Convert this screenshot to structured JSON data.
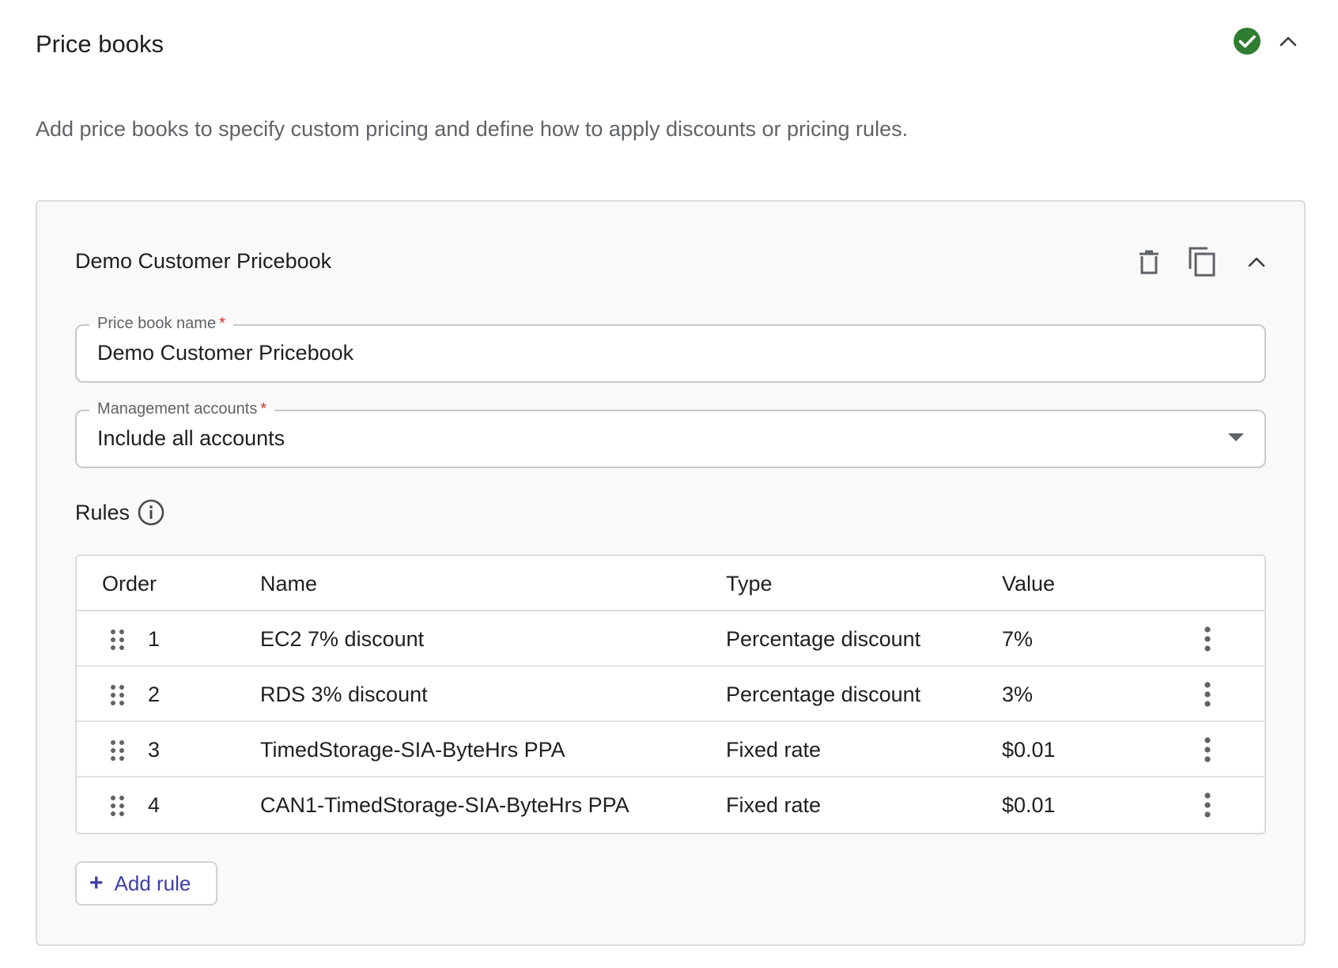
{
  "section": {
    "title": "Price books",
    "description": "Add price books to specify custom pricing and define how to apply discounts or pricing rules.",
    "status_icon": "check-circle-icon",
    "status_color": "#2e7d32"
  },
  "pricebook": {
    "title": "Demo Customer Pricebook",
    "fields": {
      "name": {
        "label": "Price book name",
        "required_mark": "*",
        "value": "Demo Customer Pricebook"
      },
      "accounts": {
        "label": "Management accounts",
        "required_mark": "*",
        "value": "Include all accounts"
      }
    },
    "rules": {
      "label": "Rules",
      "columns": [
        "Order",
        "Name",
        "Type",
        "Value"
      ],
      "rows": [
        {
          "order": "1",
          "name": "EC2 7% discount",
          "type": "Percentage discount",
          "value": "7%"
        },
        {
          "order": "2",
          "name": "RDS 3% discount",
          "type": "Percentage discount",
          "value": "3%"
        },
        {
          "order": "3",
          "name": "TimedStorage-SIA-ByteHrs PPA",
          "type": "Fixed rate",
          "value": "$0.01"
        },
        {
          "order": "4",
          "name": "CAN1-TimedStorage-SIA-ByteHrs PPA",
          "type": "Fixed rate",
          "value": "$0.01"
        }
      ]
    },
    "add_rule": {
      "icon": "+",
      "label": "Add rule"
    }
  },
  "colors": {
    "accent": "#3c3ea8",
    "required": "#d93025",
    "success": "#2e7d32"
  }
}
